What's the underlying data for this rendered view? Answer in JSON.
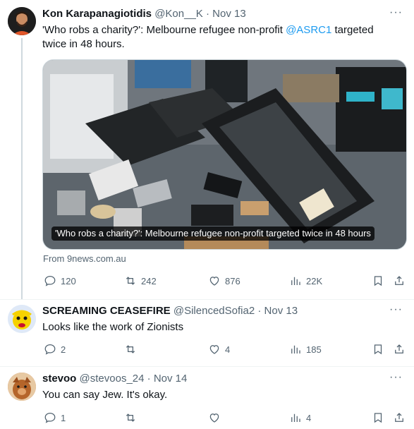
{
  "tweets": [
    {
      "name": "Kon Karapanagiotidis",
      "handle": "@Kon__K",
      "sep": " · ",
      "date": "Nov 13",
      "text_pre": "'Who robs a charity?': Melbourne refugee non-profit ",
      "mention": "@ASRC1",
      "text_post": " targeted twice in 48 hours.",
      "card_caption": "'Who robs a charity?': Melbourne refugee non-profit targeted twice in 48 hours",
      "card_source": "From 9news.com.au",
      "replies": "120",
      "reposts": "242",
      "likes": "876",
      "views": "22K"
    },
    {
      "name": "SCREAMING CEASEFIRE",
      "handle": "@SilencedSofia2",
      "sep": " · ",
      "date": "Nov 13",
      "text": "Looks like the work of Zionists",
      "replies": "2",
      "reposts": "",
      "likes": "4",
      "views": "185"
    },
    {
      "name": "stevoo",
      "handle": "@stevoos_24",
      "sep": " · ",
      "date": "Nov 14",
      "text": "You can say Jew. It's okay.",
      "replies": "1",
      "reposts": "",
      "likes": "",
      "views": "4"
    }
  ],
  "more_glyph": "···",
  "colors": {
    "accent": "#1d9bf0",
    "muted": "#536471",
    "text": "#0f1419",
    "border": "#cfd9de"
  },
  "icons": [
    "reply-icon",
    "repost-icon",
    "like-icon",
    "views-icon",
    "bookmark-icon",
    "share-icon",
    "more-icon"
  ]
}
